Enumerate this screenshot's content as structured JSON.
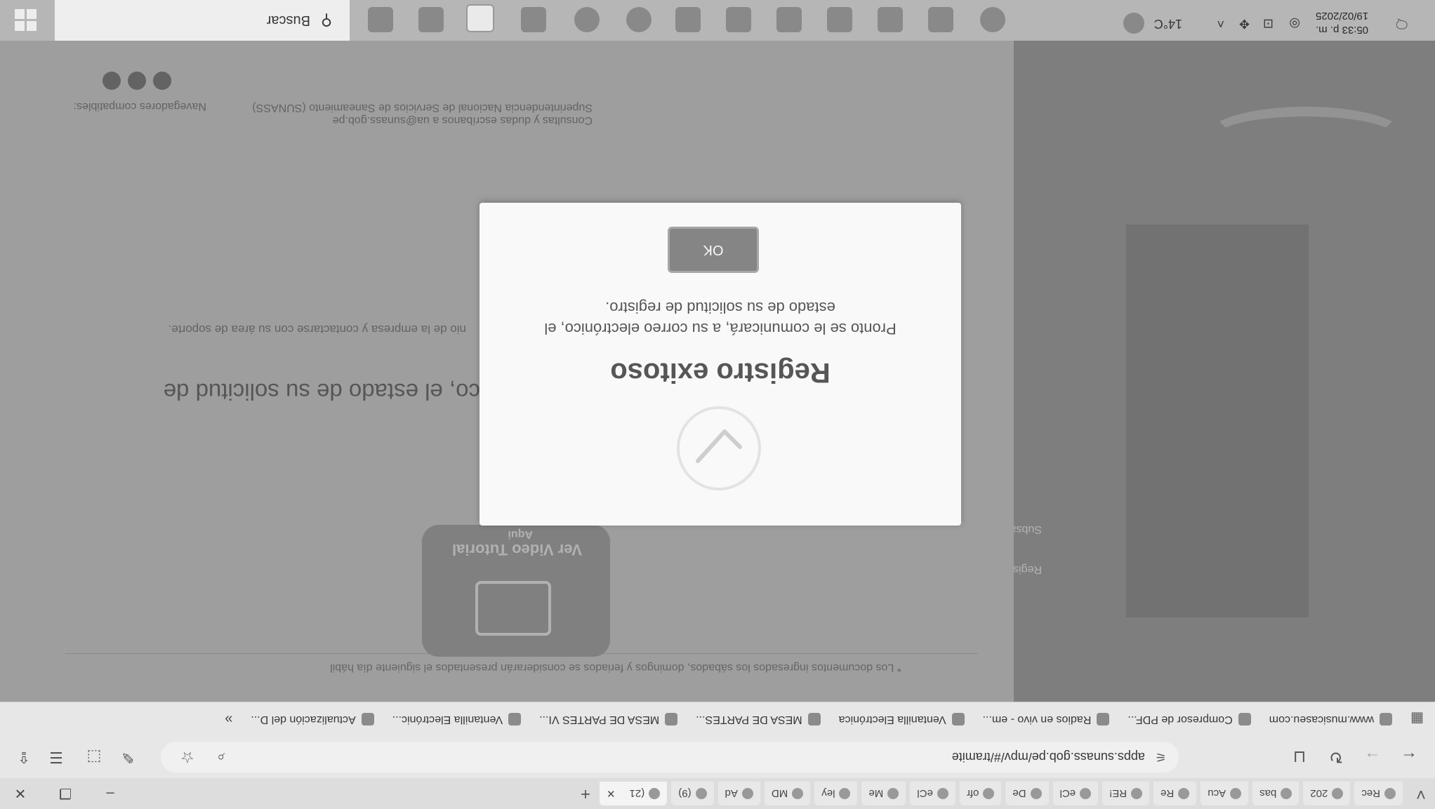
{
  "browser": {
    "tabs": [
      {
        "label": "Rec"
      },
      {
        "label": "202"
      },
      {
        "label": "bas"
      },
      {
        "label": "Acu"
      },
      {
        "label": "Re"
      },
      {
        "label": "RE!"
      },
      {
        "label": "eCl"
      },
      {
        "label": "De"
      },
      {
        "label": "ofr"
      },
      {
        "label": "eCl"
      },
      {
        "label": "Me"
      },
      {
        "label": "ley"
      },
      {
        "label": "MD"
      },
      {
        "label": "Ad"
      },
      {
        "label": "(9)"
      },
      {
        "label": "(21"
      }
    ],
    "url": "apps.sunass.gob.pe/mpv/#/tramite",
    "bookmarks": [
      {
        "label": "www.musicaseu.com"
      },
      {
        "label": "Compresor de PDF..."
      },
      {
        "label": "Radios en vivo - em..."
      },
      {
        "label": "Ventanilla Electrónica"
      },
      {
        "label": "MESA DE PARTES..."
      },
      {
        "label": "MESA DE PARTES VI..."
      },
      {
        "label": "Ventanilla Electrónic..."
      },
      {
        "label": "Actualización del D..."
      }
    ],
    "more_bookmarks": "»"
  },
  "page": {
    "nav_links": [
      "Registrar",
      "Subsanar"
    ],
    "notice": "* Los documentos ingresados los sábados, domingos y feriados se considerarán presentados el siguiente día hábil",
    "tutorial_button": "Ver Video Tutorial",
    "tutorial_sub": "Aqui",
    "big_text": "co, el estado de su solicitud de",
    "help_text": "nio de la empresa y contactarse con su área de soporte.",
    "footer_text": "Consultas y dudas escríbanos a ua@sunass.gob.pe",
    "footer_text2": "Superintendencia Nacional de Servicios de Saneamiento (SUNASS)",
    "compat_label": "Navegadores compatibles:"
  },
  "modal": {
    "title": "Registro exitoso",
    "message": "Pronto se le comunicará, a su correo electrónico, el estado de su solicitud de registro.",
    "ok_label": "OK"
  },
  "taskbar": {
    "search_label": "Buscar",
    "temperature": "14°C",
    "time": "05:33 p. m.",
    "date": "19/02/2025"
  }
}
